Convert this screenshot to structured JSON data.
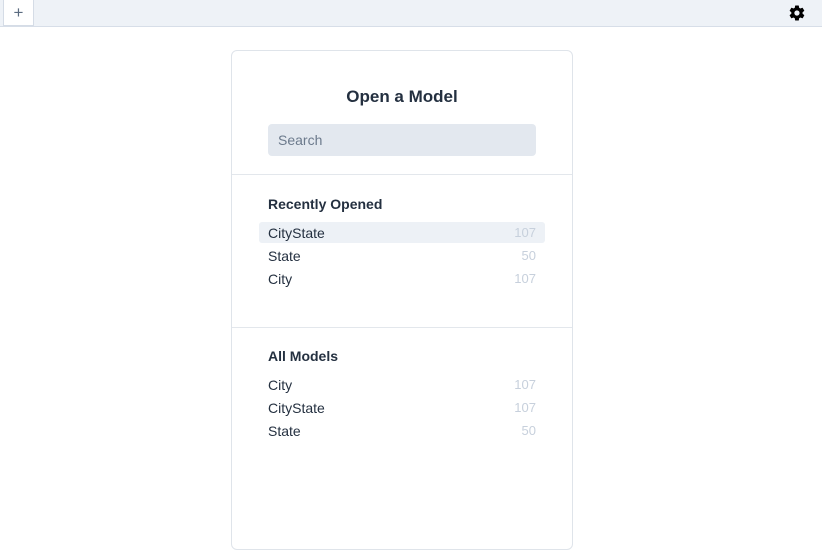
{
  "topbar": {
    "new_tab_label": "+",
    "settings_icon": "gear-icon"
  },
  "panel": {
    "title": "Open a Model",
    "search_placeholder": "Search",
    "search_value": "",
    "recent": {
      "title": "Recently Opened",
      "items": [
        {
          "name": "CityState",
          "count": "107",
          "selected": true
        },
        {
          "name": "State",
          "count": "50",
          "selected": false
        },
        {
          "name": "City",
          "count": "107",
          "selected": false
        }
      ]
    },
    "all": {
      "title": "All Models",
      "items": [
        {
          "name": "City",
          "count": "107"
        },
        {
          "name": "CityState",
          "count": "107"
        },
        {
          "name": "State",
          "count": "50"
        }
      ]
    }
  },
  "colors": {
    "topbar_bg": "#eef2f7",
    "text": "#243040",
    "count_text": "#c7d0dc",
    "selected_row": "#edf1f6"
  }
}
